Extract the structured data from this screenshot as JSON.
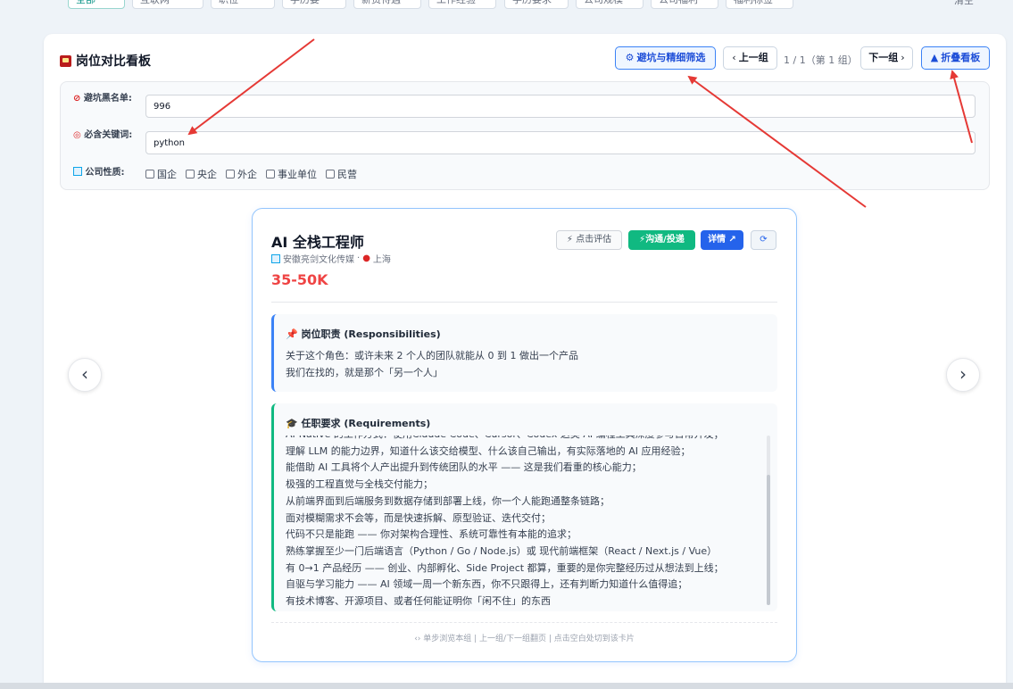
{
  "top_chips": [
    {
      "label": "全部"
    },
    {
      "label": "互联网"
    },
    {
      "label": "职位"
    },
    {
      "label": "学历要"
    },
    {
      "label": "薪资待遇"
    },
    {
      "label": "工作经验"
    },
    {
      "label": "学历要求"
    },
    {
      "label": "公司规模"
    },
    {
      "label": "公司福利"
    },
    {
      "label": "福利标签"
    }
  ],
  "top_right": "清空",
  "board": {
    "title": "岗位对比看板",
    "filter_button": "避坑与精细筛选",
    "prev_group": "上一组",
    "page_indicator": "1 / 1（第 1 组）",
    "next_group": "下一组",
    "collapse_button": "折叠看板"
  },
  "filters": {
    "blacklist_label": "避坑黑名单:",
    "blacklist_value": "996",
    "keyword_label": "必含关键词:",
    "keyword_value": "python",
    "company_type_label": "公司性质:",
    "company_types": [
      "国企",
      "央企",
      "外企",
      "事业单位",
      "民营"
    ]
  },
  "nav": {
    "prev": "‹",
    "next": "›"
  },
  "job": {
    "title": "AI 全栈工程师",
    "company": "安徽亮剑文化传媒",
    "separator": "·",
    "city": "上海",
    "salary": "35-50K",
    "eval_button": "点击评估",
    "apply_button": "沟通/投递",
    "detail_button": "详情 ↗",
    "responsibilities_title": "岗位职责 (Responsibilities)",
    "responsibilities": [
      "关于这个角色：或许未来 2 个人的团队就能从 0 到 1 做出一个产品",
      "我们在找的，就是那个「另一个人」"
    ],
    "requirements_title": "任职要求 (Requirements)",
    "requirements": [
      "AI-Native 的工作方式：使用Claude Code、Cursor、Codex 这类 AI 编程工具深度参与日常开发；",
      "理解 LLM 的能力边界，知道什么该交给模型、什么该自己输出，有实际落地的 AI 应用经验；",
      "能借助 AI 工具将个人产出提升到传统团队的水平 —— 这是我们看重的核心能力；",
      "极强的工程直觉与全栈交付能力；",
      "从前端界面到后端服务到数据存储到部署上线，你一个人能跑通整条链路；",
      "面对模糊需求不会等，而是快速拆解、原型验证、迭代交付；",
      "代码不只是能跑 —— 你对架构合理性、系统可靠性有本能的追求；",
      "熟练掌握至少一门后端语言（Python / Go / Node.js）或 现代前端框架（React / Next.js / Vue）",
      "有 0→1 产品经历 —— 创业、内部孵化、Side Project 都算，重要的是你完整经历过从想法到上线；",
      "自驱与学习能力 —— AI 领域一周一个新东西，你不只跟得上，还有判断力知道什么值得追；",
      "有技术博客、开源项目、或者任何能证明你「闲不住」的东西"
    ],
    "footer_hint": "‹› 单步浏览本组  |  上一组/下一组翻页  |  点击空白处切到该卡片"
  },
  "colors": {
    "accent_blue": "#2563eb",
    "apply_green": "#10b981",
    "salary_red": "#ef4444",
    "arrow_red": "#e53935"
  }
}
